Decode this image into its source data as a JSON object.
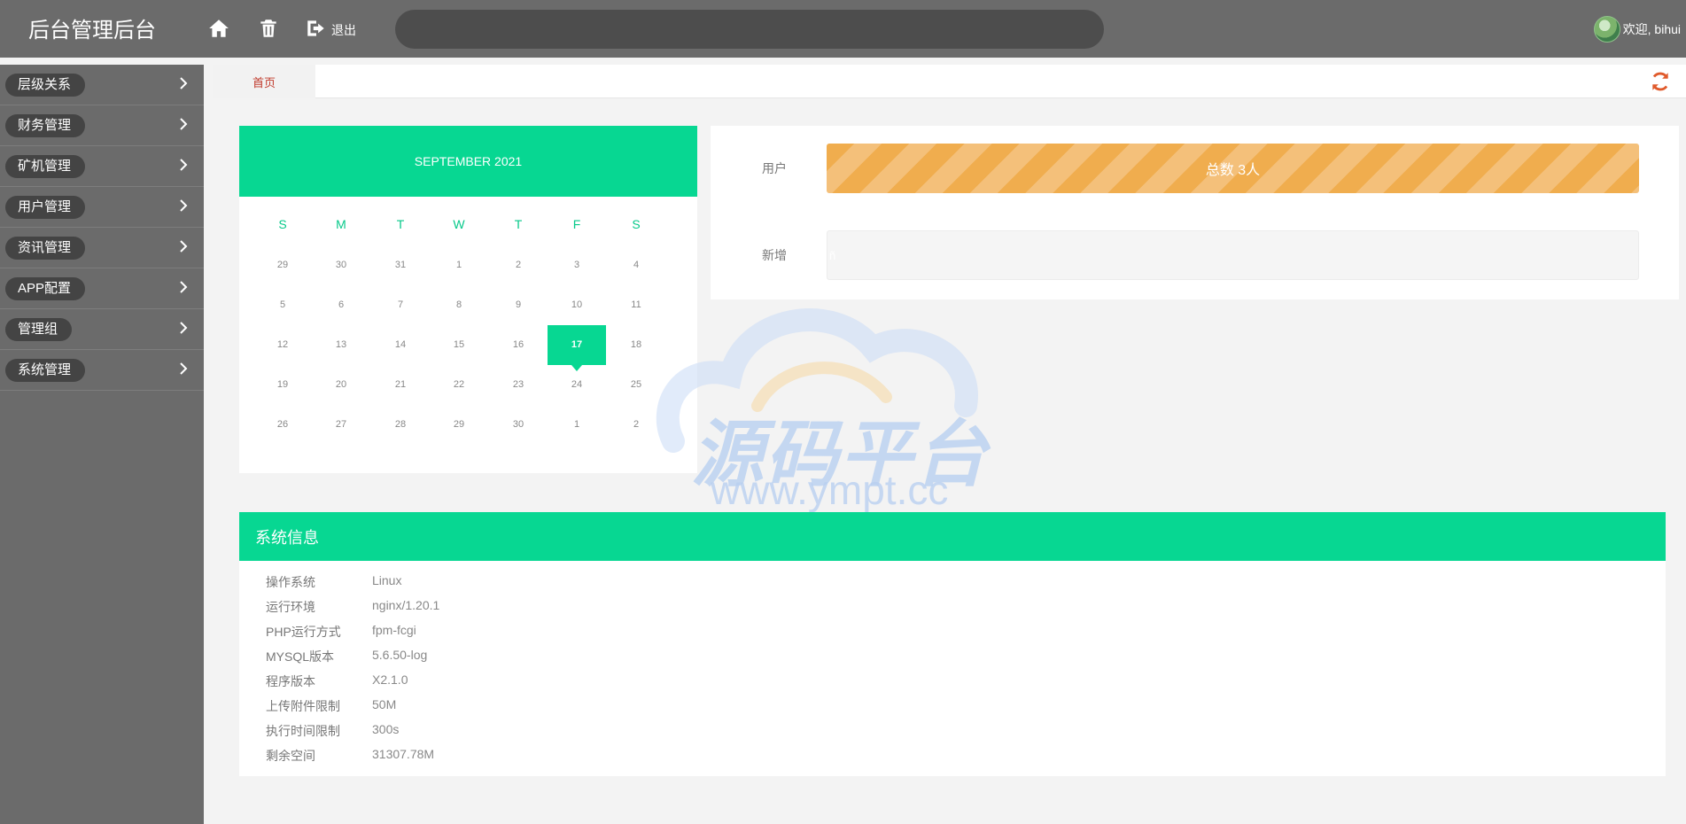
{
  "header": {
    "brand": "后台管理后台",
    "logout_label": "退出",
    "welcome": "欢迎, bihui"
  },
  "sidebar": {
    "items": [
      {
        "label": "层级关系"
      },
      {
        "label": "财务管理"
      },
      {
        "label": "矿机管理"
      },
      {
        "label": "用户管理"
      },
      {
        "label": "资讯管理"
      },
      {
        "label": "APP配置"
      },
      {
        "label": "管理组"
      },
      {
        "label": "系统管理"
      }
    ]
  },
  "tabs": {
    "home": "首页"
  },
  "calendar": {
    "title": "SEPTEMBER 2021",
    "weekdays": [
      "S",
      "M",
      "T",
      "W",
      "T",
      "F",
      "S"
    ],
    "weeks": [
      [
        "29",
        "30",
        "31",
        "1",
        "2",
        "3",
        "4"
      ],
      [
        "5",
        "6",
        "7",
        "8",
        "9",
        "10",
        "11"
      ],
      [
        "12",
        "13",
        "14",
        "15",
        "16",
        "17",
        "18"
      ],
      [
        "19",
        "20",
        "21",
        "22",
        "23",
        "24",
        "25"
      ],
      [
        "26",
        "27",
        "28",
        "29",
        "30",
        "1",
        "2"
      ]
    ],
    "selected": "17"
  },
  "stats": {
    "users_label": "用户",
    "users_value": "总数 3人",
    "new_label": "新增",
    "new_value": "ñ"
  },
  "watermark": {
    "text": "源码平台",
    "url": "www.ympt.cc"
  },
  "system": {
    "title": "系统信息",
    "rows": [
      {
        "key": "操作系统",
        "value": "Linux"
      },
      {
        "key": "运行环境",
        "value": "nginx/1.20.1"
      },
      {
        "key": "PHP运行方式",
        "value": "fpm-fcgi"
      },
      {
        "key": "MYSQL版本",
        "value": "5.6.50-log"
      },
      {
        "key": "程序版本",
        "value": "X2.1.0"
      },
      {
        "key": "上传附件限制",
        "value": "50M"
      },
      {
        "key": "执行时间限制",
        "value": "300s"
      },
      {
        "key": "剩余空间",
        "value": "31307.78M"
      }
    ]
  },
  "colors": {
    "accent": "#07d792",
    "header_bg": "#6b6b6b",
    "progress": "#f0ad4e",
    "refresh": "#e05a2b"
  }
}
